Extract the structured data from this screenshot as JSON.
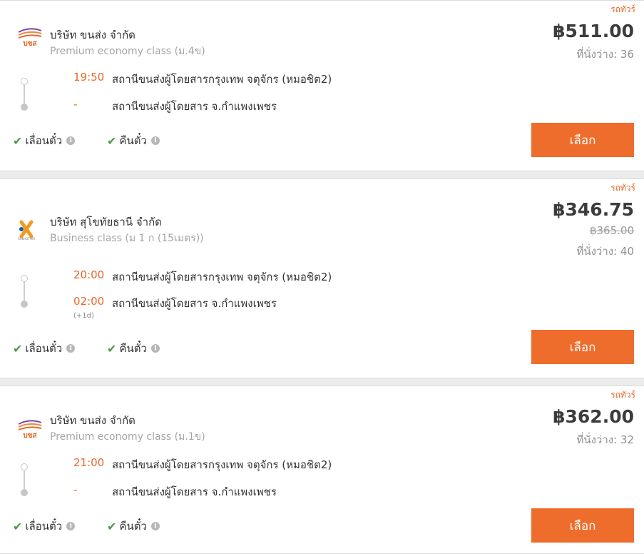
{
  "colors": {
    "accent": "#ef6d2c",
    "time": "#e8672a",
    "check": "#43a047"
  },
  "labels": {
    "tag": "รถทัวร์",
    "refund_seat": "เลื่อนตั๋ว",
    "refund_ticket": "คืนตั๋ว",
    "select": "เลือก",
    "info_icon": "i"
  },
  "trips": [
    {
      "company": "บริษัท ขนส่ง จำกัด",
      "class": "Premium economy class (ม.4ข)",
      "price": "฿511.00",
      "old_price": "",
      "seats": "ที่นั่งว่าง: 36",
      "depart_time": "19:50",
      "depart_station": "สถานีขนส่งผู้โดยสารกรุงเทพ จตุจักร (หมอชิต2)",
      "arrive_time": "-",
      "arrive_station": "สถานีขนส่งผู้โดยสาร จ.กำแพงเพชร",
      "arrive_note": "",
      "logo": "bks-logo-icon"
    },
    {
      "company": "บริษัท สุโขทัยธานี จำกัด",
      "class": "Business class (ม 1 ก (15เมตร))",
      "price": "฿346.75",
      "old_price": "฿365.00",
      "seats": "ที่นั่งว่าง: 40",
      "depart_time": "20:00",
      "depart_station": "สถานีขนส่งผู้โดยสารกรุงเทพ จตุจักร (หมอชิต2)",
      "arrive_time": "02:00",
      "arrive_station": "สถานีขนส่งผู้โดยสาร จ.กำแพงเพชร",
      "arrive_note": "(+1d)",
      "logo": "sukhothai-logo-icon"
    },
    {
      "company": "บริษัท ขนส่ง จำกัด",
      "class": "Premium economy class (ม.1ข)",
      "price": "฿362.00",
      "old_price": "",
      "seats": "ที่นั่งว่าง: 32",
      "depart_time": "21:00",
      "depart_station": "สถานีขนส่งผู้โดยสารกรุงเทพ จตุจักร (หมอชิต2)",
      "arrive_time": "-",
      "arrive_station": "สถานีขนส่งผู้โดยสาร จ.กำแพงเพชร",
      "arrive_note": "",
      "logo": "bks-logo-icon"
    }
  ]
}
